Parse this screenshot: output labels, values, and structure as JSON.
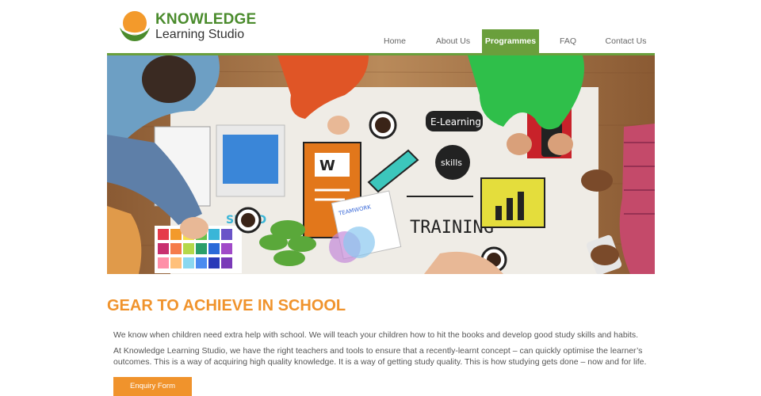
{
  "logo": {
    "line1": "KNOWLEDGE",
    "line2": "Learning Studio"
  },
  "nav": [
    "Home",
    "About Us",
    "Programmes",
    "FAQ",
    "Contact Us"
  ],
  "nav_active": "Programmes",
  "hero": {
    "board_words": {
      "elearning": "E-Learning",
      "skills": "skills",
      "training": "TRAINING",
      "teamwork": "TEAMWORK",
      "speed": "SPEED"
    }
  },
  "content": {
    "headline": "GEAR TO ACHIEVE IN SCHOOL",
    "paragraph1": "We know when children need extra help with school. We will teach your children how to hit the books and develop good study skills and habits.",
    "paragraph2": "At Knowledge Learning Studio, we have the right teachers and tools to ensure that a recently-learnt concept – can quickly optimise the learner’s outcomes. This is a way of acquiring high quality knowledge. It is a way of getting study quality. This is how studying gets done – now and for life.",
    "button": "Enquiry Form"
  },
  "colors": {
    "brand_green": "#6a9f3c",
    "accent_orange": "#f0932c"
  }
}
